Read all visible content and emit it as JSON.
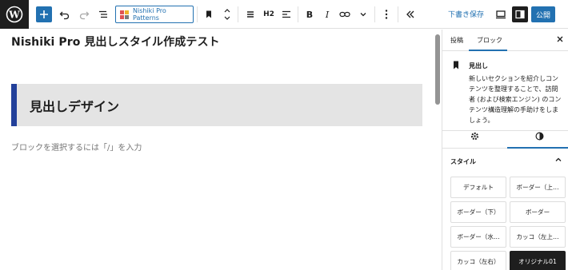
{
  "toolbar": {
    "patterns_label": "Nishiki Pro Patterns",
    "heading_level": "H2",
    "save_draft": "下書き保存",
    "publish": "公開"
  },
  "editor": {
    "post_title": "Nishiki Pro 見出しスタイル作成テスト",
    "heading_text": "見出しデザイン",
    "placeholder": "ブロックを選択するには「/」を入力"
  },
  "sidebar": {
    "tabs": [
      "投稿",
      "ブロック"
    ],
    "block_name": "見出し",
    "block_description": "新しいセクションを紹介しコンテンツを整理することで、訪問者 (および検索エンジン) のコンテンツ構造理解の手助けをしましょう。",
    "styles_title": "スタイル",
    "style_options": [
      "デフォルト",
      "ボーダー（上…",
      "ボーダー（下）",
      "ボーダー",
      "ボーダー（水…",
      "カッコ（左上…",
      "カッコ（左右）",
      "オリジナル01"
    ]
  },
  "colors": {
    "accent": "#2271b1",
    "heading_border": "#22409a",
    "heading_bg": "#e4e4e4",
    "dark": "#1e1e1e"
  }
}
